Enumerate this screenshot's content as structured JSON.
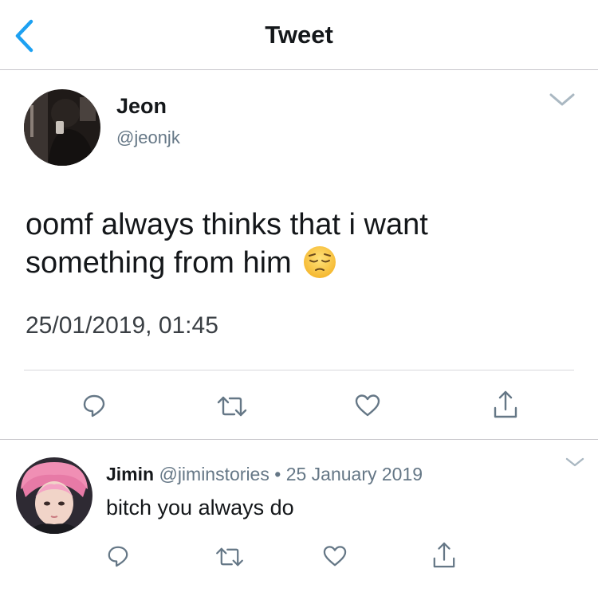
{
  "nav": {
    "title": "Tweet",
    "back_icon": "chevron-left-icon"
  },
  "tweet": {
    "author_name": "Jeon",
    "author_handle": "@jeonjk",
    "text": "oomf always thinks that i want something from him",
    "emoji": "pensive-face",
    "timestamp": "25/01/2019, 01:45",
    "actions": [
      "reply-icon",
      "retweet-icon",
      "like-icon",
      "share-icon"
    ]
  },
  "reply": {
    "author_name": "Jimin",
    "author_handle": "@jiminstories",
    "separator": "•",
    "date": "25 January 2019",
    "text": "bitch you always do",
    "actions": [
      "reply-icon",
      "retweet-icon",
      "like-icon",
      "share-icon"
    ]
  },
  "colors": {
    "accent": "#1da1f2",
    "text": "#14171a",
    "secondary": "#657786",
    "icon": "#657786"
  }
}
